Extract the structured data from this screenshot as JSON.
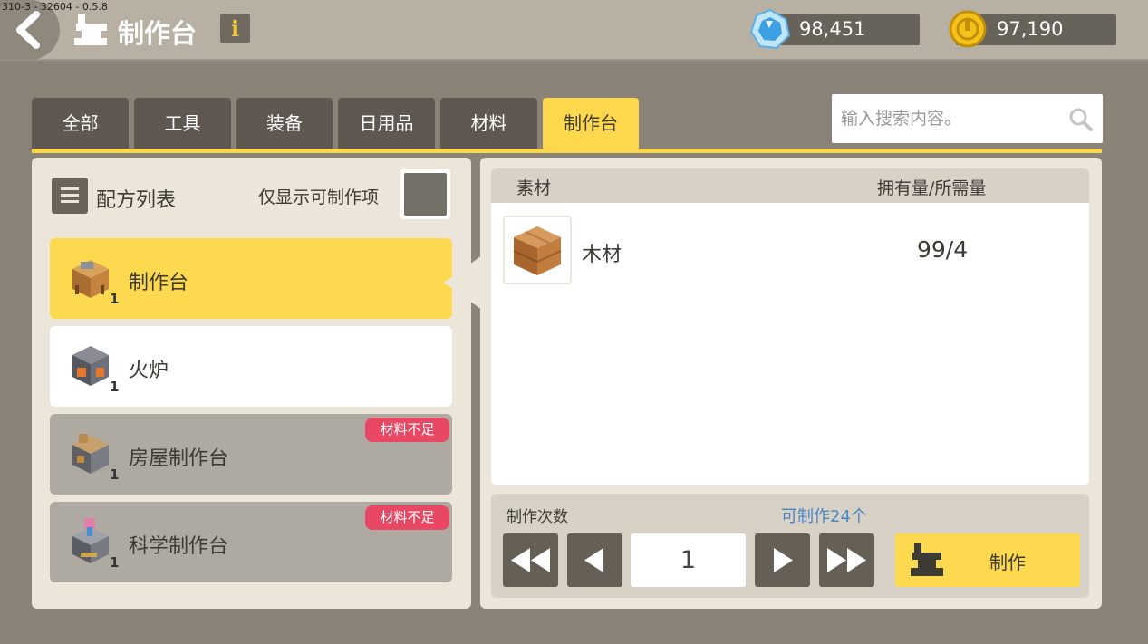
{
  "version": "310-3 - 32604 - 0.5.8",
  "header": {
    "title": "制作台",
    "info_label": "i",
    "gems": "98,451",
    "coins": "97,190"
  },
  "tabs": [
    {
      "label": "全部"
    },
    {
      "label": "工具"
    },
    {
      "label": "装备"
    },
    {
      "label": "日用品"
    },
    {
      "label": "材料"
    },
    {
      "label": "制作台"
    }
  ],
  "active_tab": "制作台",
  "search": {
    "placeholder": "输入搜索内容。",
    "value": ""
  },
  "recipes": {
    "title": "配方列表",
    "filter_label": "仅显示可制作项",
    "items": [
      {
        "name": "制作台",
        "qty": "1",
        "state": "selected",
        "icon": "workbench-icon"
      },
      {
        "name": "火炉",
        "qty": "1",
        "state": "normal",
        "icon": "furnace-icon"
      },
      {
        "name": "房屋制作台",
        "qty": "1",
        "state": "disabled",
        "badge": "材料不足",
        "icon": "house-workbench-icon"
      },
      {
        "name": "科学制作台",
        "qty": "1",
        "state": "disabled",
        "badge": "材料不足",
        "icon": "science-workbench-icon"
      }
    ]
  },
  "materials": {
    "col_material": "素材",
    "col_count": "拥有量/所需量",
    "rows": [
      {
        "name": "木材",
        "count": "99/4",
        "icon": "wood-icon"
      }
    ]
  },
  "craft": {
    "count_label": "制作次数",
    "available_label": "可制作24个",
    "count": "1",
    "button_label": "制作"
  },
  "colors": {
    "accent_yellow": "#fdd74c",
    "badge_red": "#e94865",
    "link_blue": "#4a86c4"
  }
}
